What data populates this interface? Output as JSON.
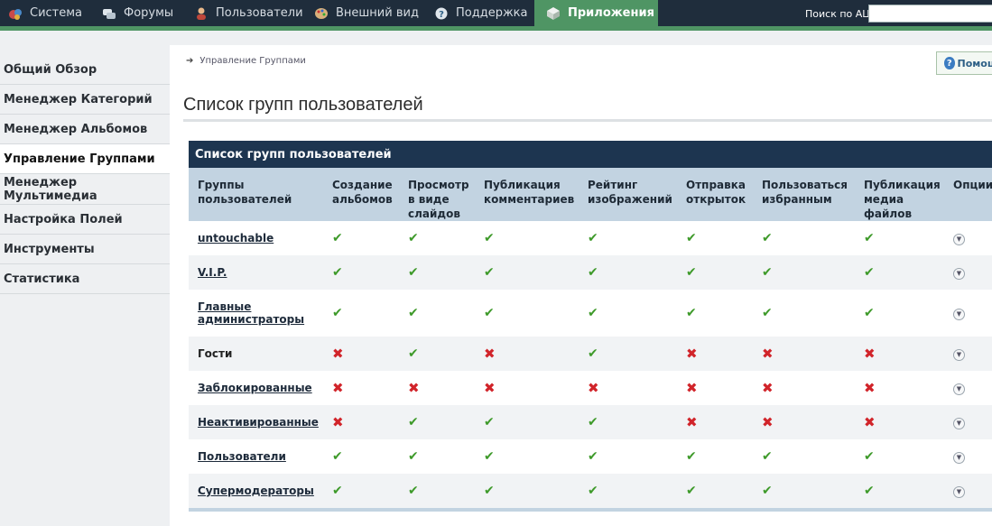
{
  "topnav": {
    "items": [
      {
        "label": "Система",
        "icon": "system-icon"
      },
      {
        "label": "Форумы",
        "icon": "forums-icon"
      },
      {
        "label": "Пользователи",
        "icon": "users-icon"
      },
      {
        "label": "Внешний вид",
        "icon": "palette-icon"
      },
      {
        "label": "Поддержка",
        "icon": "support-icon"
      },
      {
        "label": "Приложения",
        "icon": "apps-icon"
      }
    ],
    "search_label": "Поиск по АЦ",
    "search_value": ""
  },
  "sidebar": {
    "items": [
      {
        "label": "Общий Обзор"
      },
      {
        "label": "Менеджер Категорий"
      },
      {
        "label": "Менеджер Альбомов"
      },
      {
        "label": "Управление Группами"
      },
      {
        "label": "Менеджер Мультимедиа"
      },
      {
        "label": "Настройка Полей"
      },
      {
        "label": "Инструменты"
      },
      {
        "label": "Статистика"
      }
    ]
  },
  "breadcrumb": {
    "label": "Управление Группами"
  },
  "help_button": {
    "label": "Помощ"
  },
  "page_title": "Список групп пользователей",
  "table": {
    "caption": "Список групп пользователей",
    "columns": [
      "Группы пользователей",
      "Создание альбомов",
      "Просмотр в виде слайдов",
      "Публикация комментариев",
      "Рейтинг изображений",
      "Отправка открыток",
      "Пользоваться избранным",
      "Публикация медиа файлов",
      "Опции"
    ],
    "rows": [
      {
        "name": "untouchable",
        "link": true,
        "perms": [
          1,
          1,
          1,
          1,
          1,
          1,
          1
        ]
      },
      {
        "name": "V.I.P.",
        "link": true,
        "perms": [
          1,
          1,
          1,
          1,
          1,
          1,
          1
        ]
      },
      {
        "name": "Главные администраторы",
        "link": true,
        "perms": [
          1,
          1,
          1,
          1,
          1,
          1,
          1
        ]
      },
      {
        "name": "Гости",
        "link": false,
        "perms": [
          0,
          1,
          0,
          1,
          0,
          0,
          0
        ]
      },
      {
        "name": "Заблокированные",
        "link": true,
        "perms": [
          0,
          0,
          0,
          0,
          0,
          0,
          0
        ]
      },
      {
        "name": "Неактивированные",
        "link": true,
        "perms": [
          0,
          1,
          1,
          1,
          0,
          0,
          0
        ]
      },
      {
        "name": "Пользователи",
        "link": true,
        "perms": [
          1,
          1,
          1,
          1,
          1,
          1,
          1
        ]
      },
      {
        "name": "Супермодераторы",
        "link": true,
        "perms": [
          1,
          1,
          1,
          1,
          1,
          1,
          1
        ]
      }
    ]
  },
  "colors": {
    "nav_bg": "#1f2d3c",
    "accent_green": "#4f9564",
    "header_dark": "#1d3550",
    "header_light": "#c2d3e1",
    "yes": "#3e9a2a",
    "no": "#d1242a"
  }
}
